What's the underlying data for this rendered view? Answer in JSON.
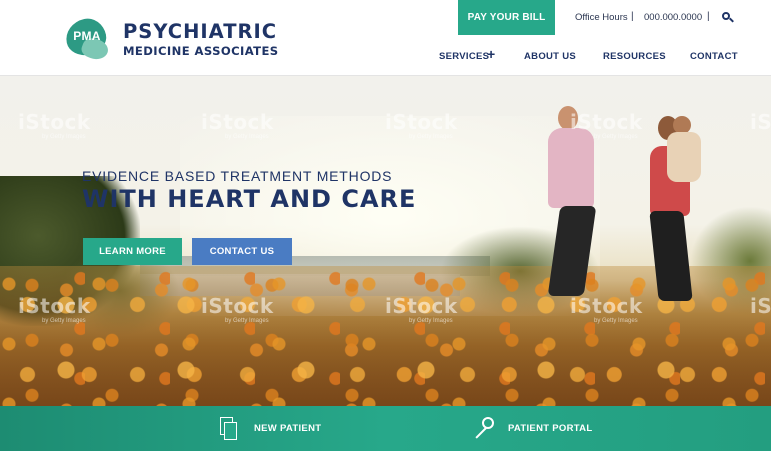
{
  "brand": {
    "badge_text": "PMA",
    "name_line1": "PSYCHIATRIC",
    "name_line2": "MEDICINE ASSOCIATES"
  },
  "utility": {
    "pay_bill_label": "PAY YOUR BILL",
    "office_hours_label": "Office Hours",
    "phone": "000.000.0000",
    "separator": "|",
    "search_icon": "search-icon"
  },
  "nav": {
    "services": "SERVICES",
    "services_expand": "+",
    "about": "ABOUT US",
    "resources": "RESOURCES",
    "contact": "CONTACT"
  },
  "hero": {
    "subtitle": "EVIDENCE BASED TREATMENT METHODS",
    "title": "WITH HEART AND CARE",
    "learn_more": "LEARN MORE",
    "contact_us": "CONTACT US",
    "watermark": "iStock",
    "watermark_sub": "by Getty Images"
  },
  "quick_links": {
    "new_patient": "NEW PATIENT",
    "patient_portal": "PATIENT PORTAL",
    "new_patient_icon": "document-icon",
    "patient_portal_icon": "key-icon"
  },
  "colors": {
    "teal": "#27a88a",
    "navy": "#1f3466",
    "blue": "#4a7cc3"
  }
}
